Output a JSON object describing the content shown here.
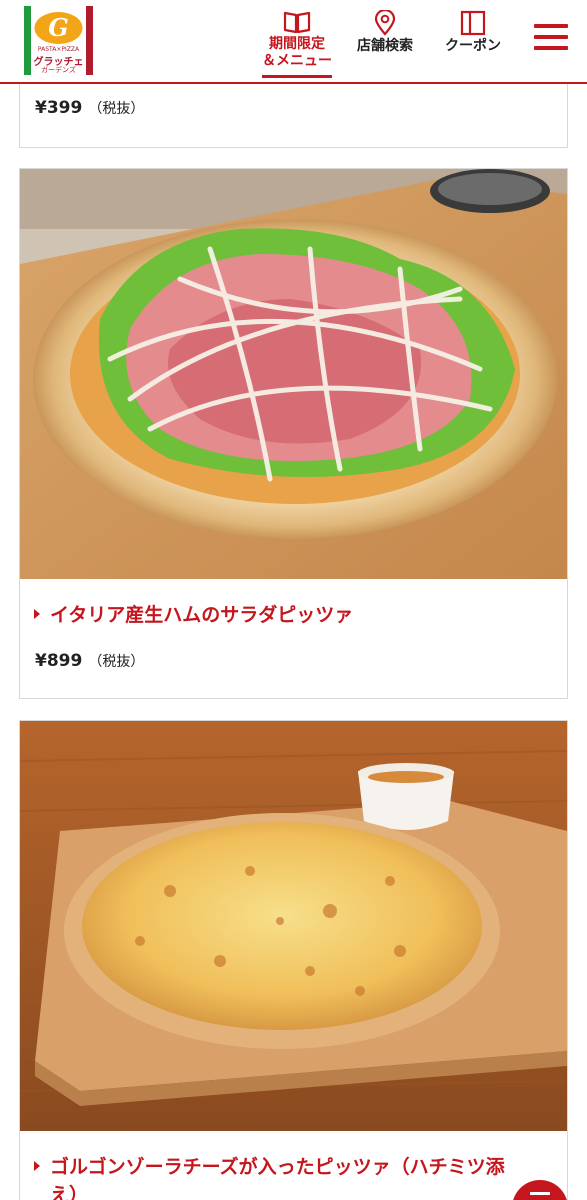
{
  "header": {
    "logo": {
      "top_text": "PASTA×PIZZA",
      "brand_text": "グラッチェ",
      "sub_text": "ガーデンズ"
    },
    "nav": {
      "limited": {
        "line1": "期間限定",
        "line2": "＆メニュー",
        "icon": "book-icon"
      },
      "store": {
        "label": "店舗検索",
        "icon": "map-pin-icon"
      },
      "coupon": {
        "label": "クーポン",
        "icon": "coupon-icon"
      }
    },
    "menu_icon": "hamburger-icon",
    "accent": "#c4161c"
  },
  "items": [
    {
      "price": "¥399",
      "tax": "（税抜）"
    },
    {
      "name": "イタリア産生ハムのサラダピッツァ",
      "price": "¥899",
      "tax": "（税抜）"
    },
    {
      "name_line1": "ゴルゴンゾーラチーズが入ったピッツァ（ハチミツ添",
      "name_line2": "え）"
    }
  ]
}
